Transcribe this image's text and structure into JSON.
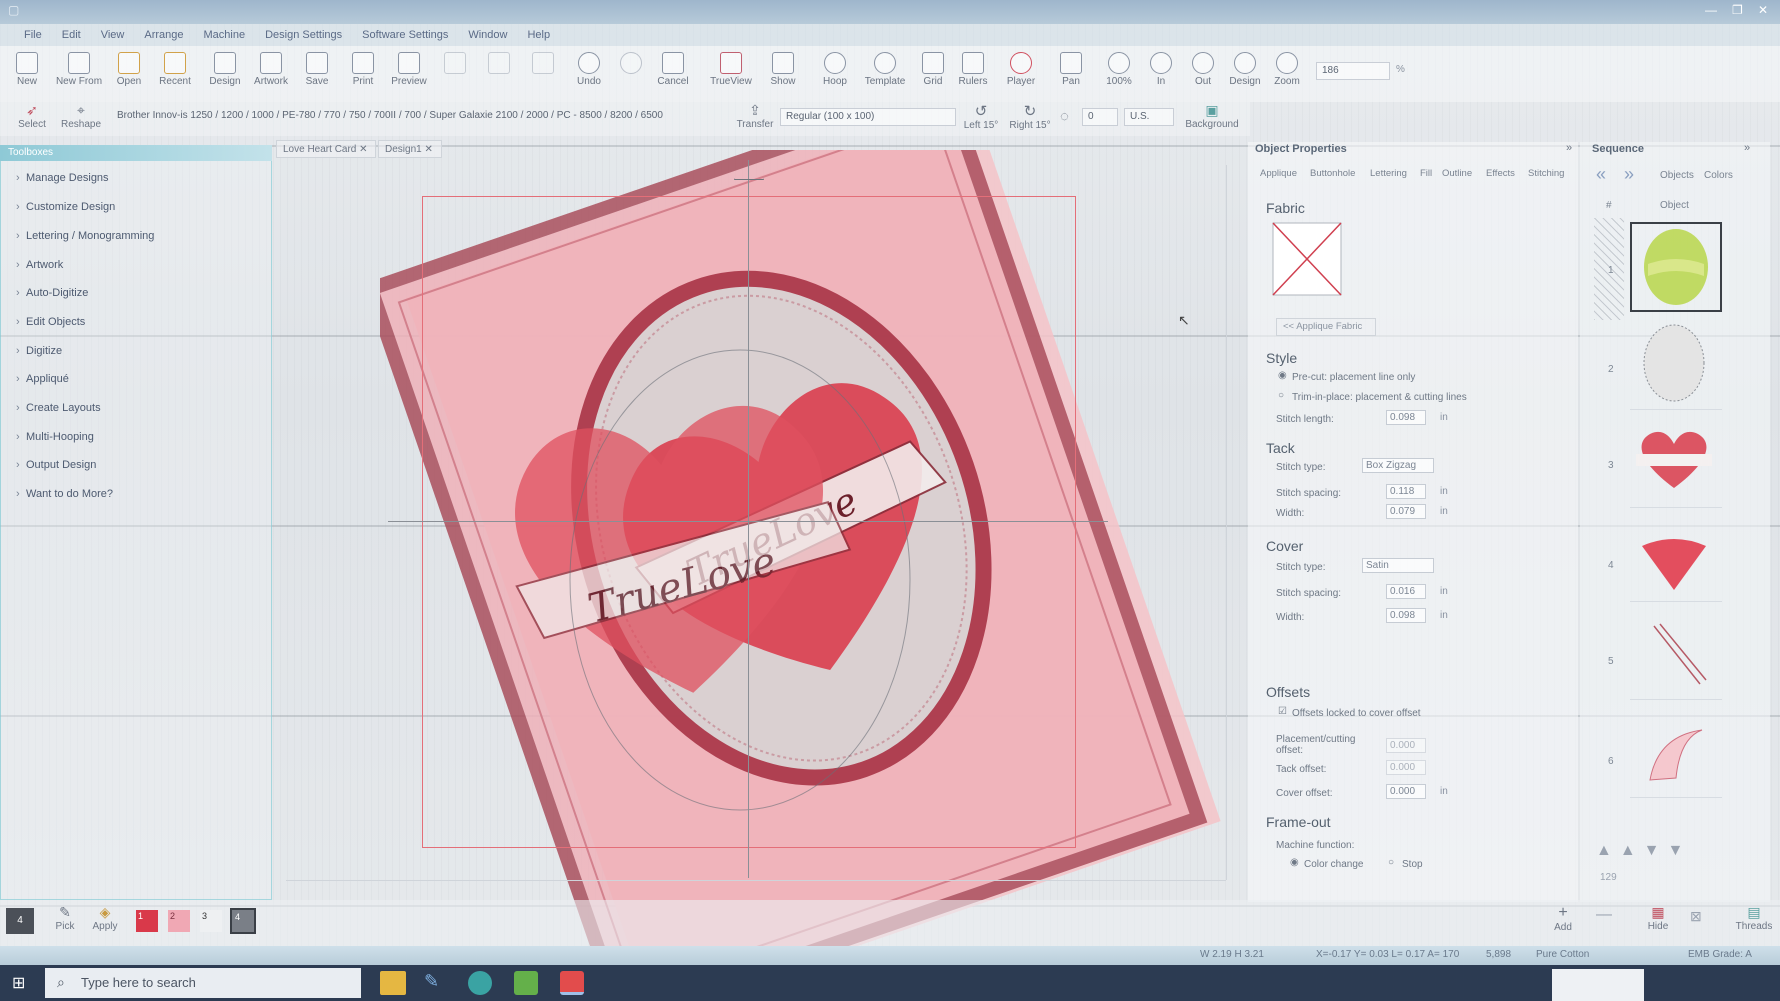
{
  "menu": [
    "File",
    "Edit",
    "View",
    "Arrange",
    "Machine",
    "Design Settings",
    "Software Settings",
    "Window",
    "Help"
  ],
  "toolbar": {
    "buttons": [
      "New",
      "New From",
      "Open",
      "Recent",
      "Design",
      "Artwork",
      "Save",
      "Print",
      "Preview",
      "Undo",
      "Cancel",
      "TrueView",
      "Show",
      "Hoop",
      "Template",
      "Grid",
      "Rulers",
      "Player",
      "Pan",
      "100%",
      "In",
      "Out",
      "Design",
      "Zoom"
    ],
    "zoom_value": "186",
    "zoom_unit": "%"
  },
  "toolbar2": {
    "select_label": "Select",
    "reshape_label": "Reshape",
    "machine_combo": "Brother Innov-is 1250 / 1200 / 1000 / PE-780 / 770 / 750 / 700II / 700 / Super Galaxie 2100 / 2000 / PC - 8500 / 8200 / 6500",
    "transfer_label": "Transfer",
    "hoop_combo": "Regular (100 x 100)",
    "left_label": "Left 15°",
    "right_label": "Right 15°",
    "angle_value": "0",
    "units": "U.S.",
    "background_label": "Background"
  },
  "toolbox": {
    "header": "Toolboxes",
    "items": [
      "Manage Designs",
      "Customize Design",
      "Lettering / Monogramming",
      "Artwork",
      "Auto-Digitize",
      "Edit Objects",
      "Digitize",
      "Appliqué",
      "Create Layouts",
      "Multi-Hooping",
      "Output Design",
      "Want to do More?"
    ]
  },
  "design_tabs": [
    "Love Heart Card",
    "Design1"
  ],
  "canvas": {
    "card_text": "TrueLove"
  },
  "object_properties": {
    "title": "Object Properties",
    "tabs": [
      "Applique",
      "Buttonhole",
      "Lettering",
      "Fill",
      "Outline",
      "Effects",
      "Stitching"
    ],
    "fabric_heading": "Fabric",
    "applique_fabric_button": "<< Applique Fabric",
    "style_heading": "Style",
    "style_options": [
      "Pre-cut: placement line only",
      "Trim-in-place: placement & cutting lines"
    ],
    "stitch_length_label": "Stitch length:",
    "stitch_length": "0.098",
    "tack_heading": "Tack",
    "tack_stitch_type_label": "Stitch type:",
    "tack_stitch_type": "Box Zigzag",
    "tack_spacing_label": "Stitch spacing:",
    "tack_spacing": "0.118",
    "tack_width_label": "Width:",
    "tack_width": "0.079",
    "cover_heading": "Cover",
    "cover_stitch_type_label": "Stitch type:",
    "cover_stitch_type": "Satin",
    "cover_spacing_label": "Stitch spacing:",
    "cover_spacing": "0.016",
    "cover_width_label": "Width:",
    "cover_width": "0.098",
    "offsets_heading": "Offsets",
    "offsets_locked": "Offsets locked to cover offset",
    "placement_offset_label": "Placement/cutting offset:",
    "placement_offset": "0.000",
    "tack_offset_label": "Tack offset:",
    "tack_offset": "0.000",
    "cover_offset_label": "Cover offset:",
    "cover_offset": "0.000",
    "unit": "in",
    "frameout_heading": "Frame-out",
    "machine_function_label": "Machine function:",
    "machine_function_options": [
      "Color change",
      "Stop"
    ]
  },
  "sequence": {
    "title": "Sequence",
    "tabs": [
      "Objects",
      "Colors"
    ],
    "col_num": "#",
    "col_object": "Object",
    "rows": [
      "1",
      "2",
      "3",
      "4",
      "5",
      "6"
    ],
    "count": "129"
  },
  "bottombar": {
    "pick_label": "Pick",
    "apply_label": "Apply",
    "swatch_numbers": [
      "1",
      "2",
      "3",
      "4"
    ],
    "add_label": "Add",
    "hide_label": "Hide",
    "threads_label": "Threads"
  },
  "status": {
    "size": "W 2.19 H 3.21",
    "coords": "X=-0.17 Y= 0.03 L= 0.17 A= 170",
    "stitches": "5,898",
    "fabric": "Pure Cotton",
    "grade": "EMB Grade: A"
  },
  "taskbar": {
    "search_placeholder": "Type here to search"
  },
  "colors": {
    "accent": "#e46e78",
    "card": "#f2b8bf",
    "card_border": "#b7515f",
    "heart": "#d9394a"
  }
}
